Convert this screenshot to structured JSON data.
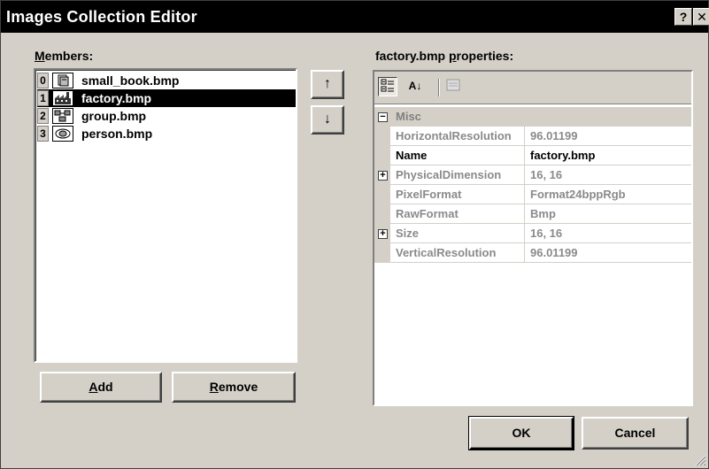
{
  "window": {
    "title": "Images Collection Editor",
    "help_label": "?",
    "close_label": "✕"
  },
  "members": {
    "label": "Members:",
    "label_mnemonic": "M",
    "label_rest": "embers:",
    "items": [
      {
        "index": "0",
        "name": "small_book.bmp",
        "icon": "book-icon"
      },
      {
        "index": "1",
        "name": "factory.bmp",
        "icon": "factory-icon",
        "selected": true
      },
      {
        "index": "2",
        "name": "group.bmp",
        "icon": "group-icon"
      },
      {
        "index": "3",
        "name": "person.bmp",
        "icon": "person-icon"
      }
    ],
    "move_up_label": "↑",
    "move_down_label": "↓"
  },
  "buttons": {
    "add_mnemonic": "A",
    "add_rest": "dd",
    "remove_mnemonic": "R",
    "remove_rest": "emove",
    "ok": "OK",
    "cancel": "Cancel"
  },
  "properties": {
    "title_pre": "factory.bmp ",
    "title_mnemonic": "p",
    "title_rest": "roperties:",
    "toolbar": {
      "categorized_icon": "categorized-icon",
      "alphabetical_label": "A↓",
      "property_pages_icon": "property-pages-icon"
    },
    "category": "Misc",
    "rows": [
      {
        "name": "HorizontalResolution",
        "value": "96.01199",
        "expandable": false,
        "active": false
      },
      {
        "name": "Name",
        "value": "factory.bmp",
        "expandable": false,
        "active": true
      },
      {
        "name": "PhysicalDimension",
        "value": "16, 16",
        "expandable": true,
        "active": false
      },
      {
        "name": "PixelFormat",
        "value": "Format24bppRgb",
        "expandable": false,
        "active": false
      },
      {
        "name": "RawFormat",
        "value": "Bmp",
        "expandable": false,
        "active": false
      },
      {
        "name": "Size",
        "value": "16, 16",
        "expandable": true,
        "active": false
      },
      {
        "name": "VerticalResolution",
        "value": "96.01199",
        "expandable": false,
        "active": false
      }
    ]
  },
  "colors": {
    "face": "#d4d0c8",
    "title_bar": "#000000",
    "selection": "#000000"
  }
}
